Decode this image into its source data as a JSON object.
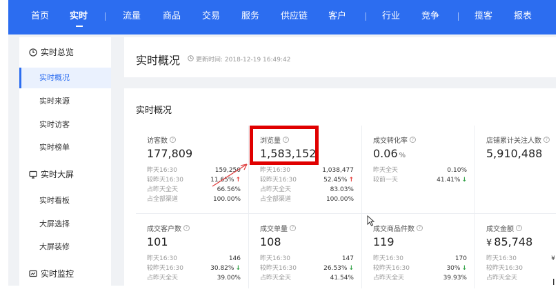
{
  "nav": {
    "items": [
      "首页",
      "实时",
      "流量",
      "商品",
      "交易",
      "服务",
      "供应链",
      "客户",
      "行业",
      "竞争",
      "揽客",
      "报表"
    ],
    "active": "实时"
  },
  "sidebar": {
    "groups": [
      {
        "title": "实时总览",
        "icon": "clock-icon",
        "items": [
          "实时概况",
          "实时来源",
          "实时访客",
          "实时榜单"
        ]
      },
      {
        "title": "实时大屏",
        "icon": "monitor-icon",
        "items": [
          "实时看板",
          "大屏选择",
          "大屏装修"
        ]
      },
      {
        "title": "实时监控",
        "icon": "monitor-watch-icon",
        "items": []
      }
    ],
    "active_item": "实时概况"
  },
  "header": {
    "title": "实时概况",
    "update_label": "更新时间: 2018-12-19 16:49:42"
  },
  "section": {
    "title": "实时概况"
  },
  "metrics": [
    {
      "label": "访客数",
      "value": "177,809",
      "rows": [
        {
          "label": "昨天16:30",
          "value": "159,250",
          "trend": ""
        },
        {
          "label": "较昨天16:30",
          "value": "11.65%",
          "trend": "up"
        },
        {
          "label": "占昨天全天",
          "value": "66.56%",
          "trend": ""
        },
        {
          "label": "占全部渠道",
          "value": "100.00%",
          "trend": ""
        }
      ]
    },
    {
      "label": "浏览量",
      "value": "1,583,152",
      "rows": [
        {
          "label": "昨天16:30",
          "value": "1,038,477",
          "trend": ""
        },
        {
          "label": "较昨天16:30",
          "value": "52.45%",
          "trend": "up"
        },
        {
          "label": "占昨天全天",
          "value": "83.03%",
          "trend": ""
        },
        {
          "label": "占全部渠道",
          "value": "100.00%",
          "trend": ""
        }
      ]
    },
    {
      "label": "成交转化率",
      "value": "0.06",
      "unit": "%",
      "rows": [
        {
          "label": "昨天全天",
          "value": "0.10%",
          "trend": ""
        },
        {
          "label": "较前一天",
          "value": "41.41%",
          "trend": "down"
        }
      ]
    },
    {
      "label": "店铺累计关注人数",
      "value": "5,910,488",
      "rows": []
    },
    {
      "label": "成交客户数",
      "value": "101",
      "rows": [
        {
          "label": "昨天16:30",
          "value": "146",
          "trend": ""
        },
        {
          "label": "较昨天16:30",
          "value": "30.82%",
          "trend": "down"
        },
        {
          "label": "占昨天全天",
          "value": "39.00%",
          "trend": ""
        }
      ]
    },
    {
      "label": "成交单量",
      "value": "108",
      "rows": [
        {
          "label": "昨天16:30",
          "value": "147",
          "trend": ""
        },
        {
          "label": "较昨天16:30",
          "value": "26.53%",
          "trend": "down"
        },
        {
          "label": "占昨天全天",
          "value": "41.54%",
          "trend": ""
        }
      ]
    },
    {
      "label": "成交商品件数",
      "value": "119",
      "rows": [
        {
          "label": "昨天16:30",
          "value": "170",
          "trend": ""
        },
        {
          "label": "较昨天16:30",
          "value": "30%",
          "trend": "down"
        },
        {
          "label": "占昨天全天",
          "value": "39.93%",
          "trend": ""
        }
      ]
    },
    {
      "label": "成交金额",
      "value": "85,748",
      "currency": "¥",
      "rows": [
        {
          "label": "昨天16:30",
          "value": "¥",
          "trend": ""
        },
        {
          "label": "较昨天16:30",
          "value": "",
          "trend": ""
        },
        {
          "label": "占昨天全天",
          "value": "",
          "trend": ""
        }
      ]
    }
  ],
  "colors": {
    "brand": "#2c6df0",
    "up": "#e53935",
    "down": "#2ea044",
    "highlight": "#e00000"
  }
}
